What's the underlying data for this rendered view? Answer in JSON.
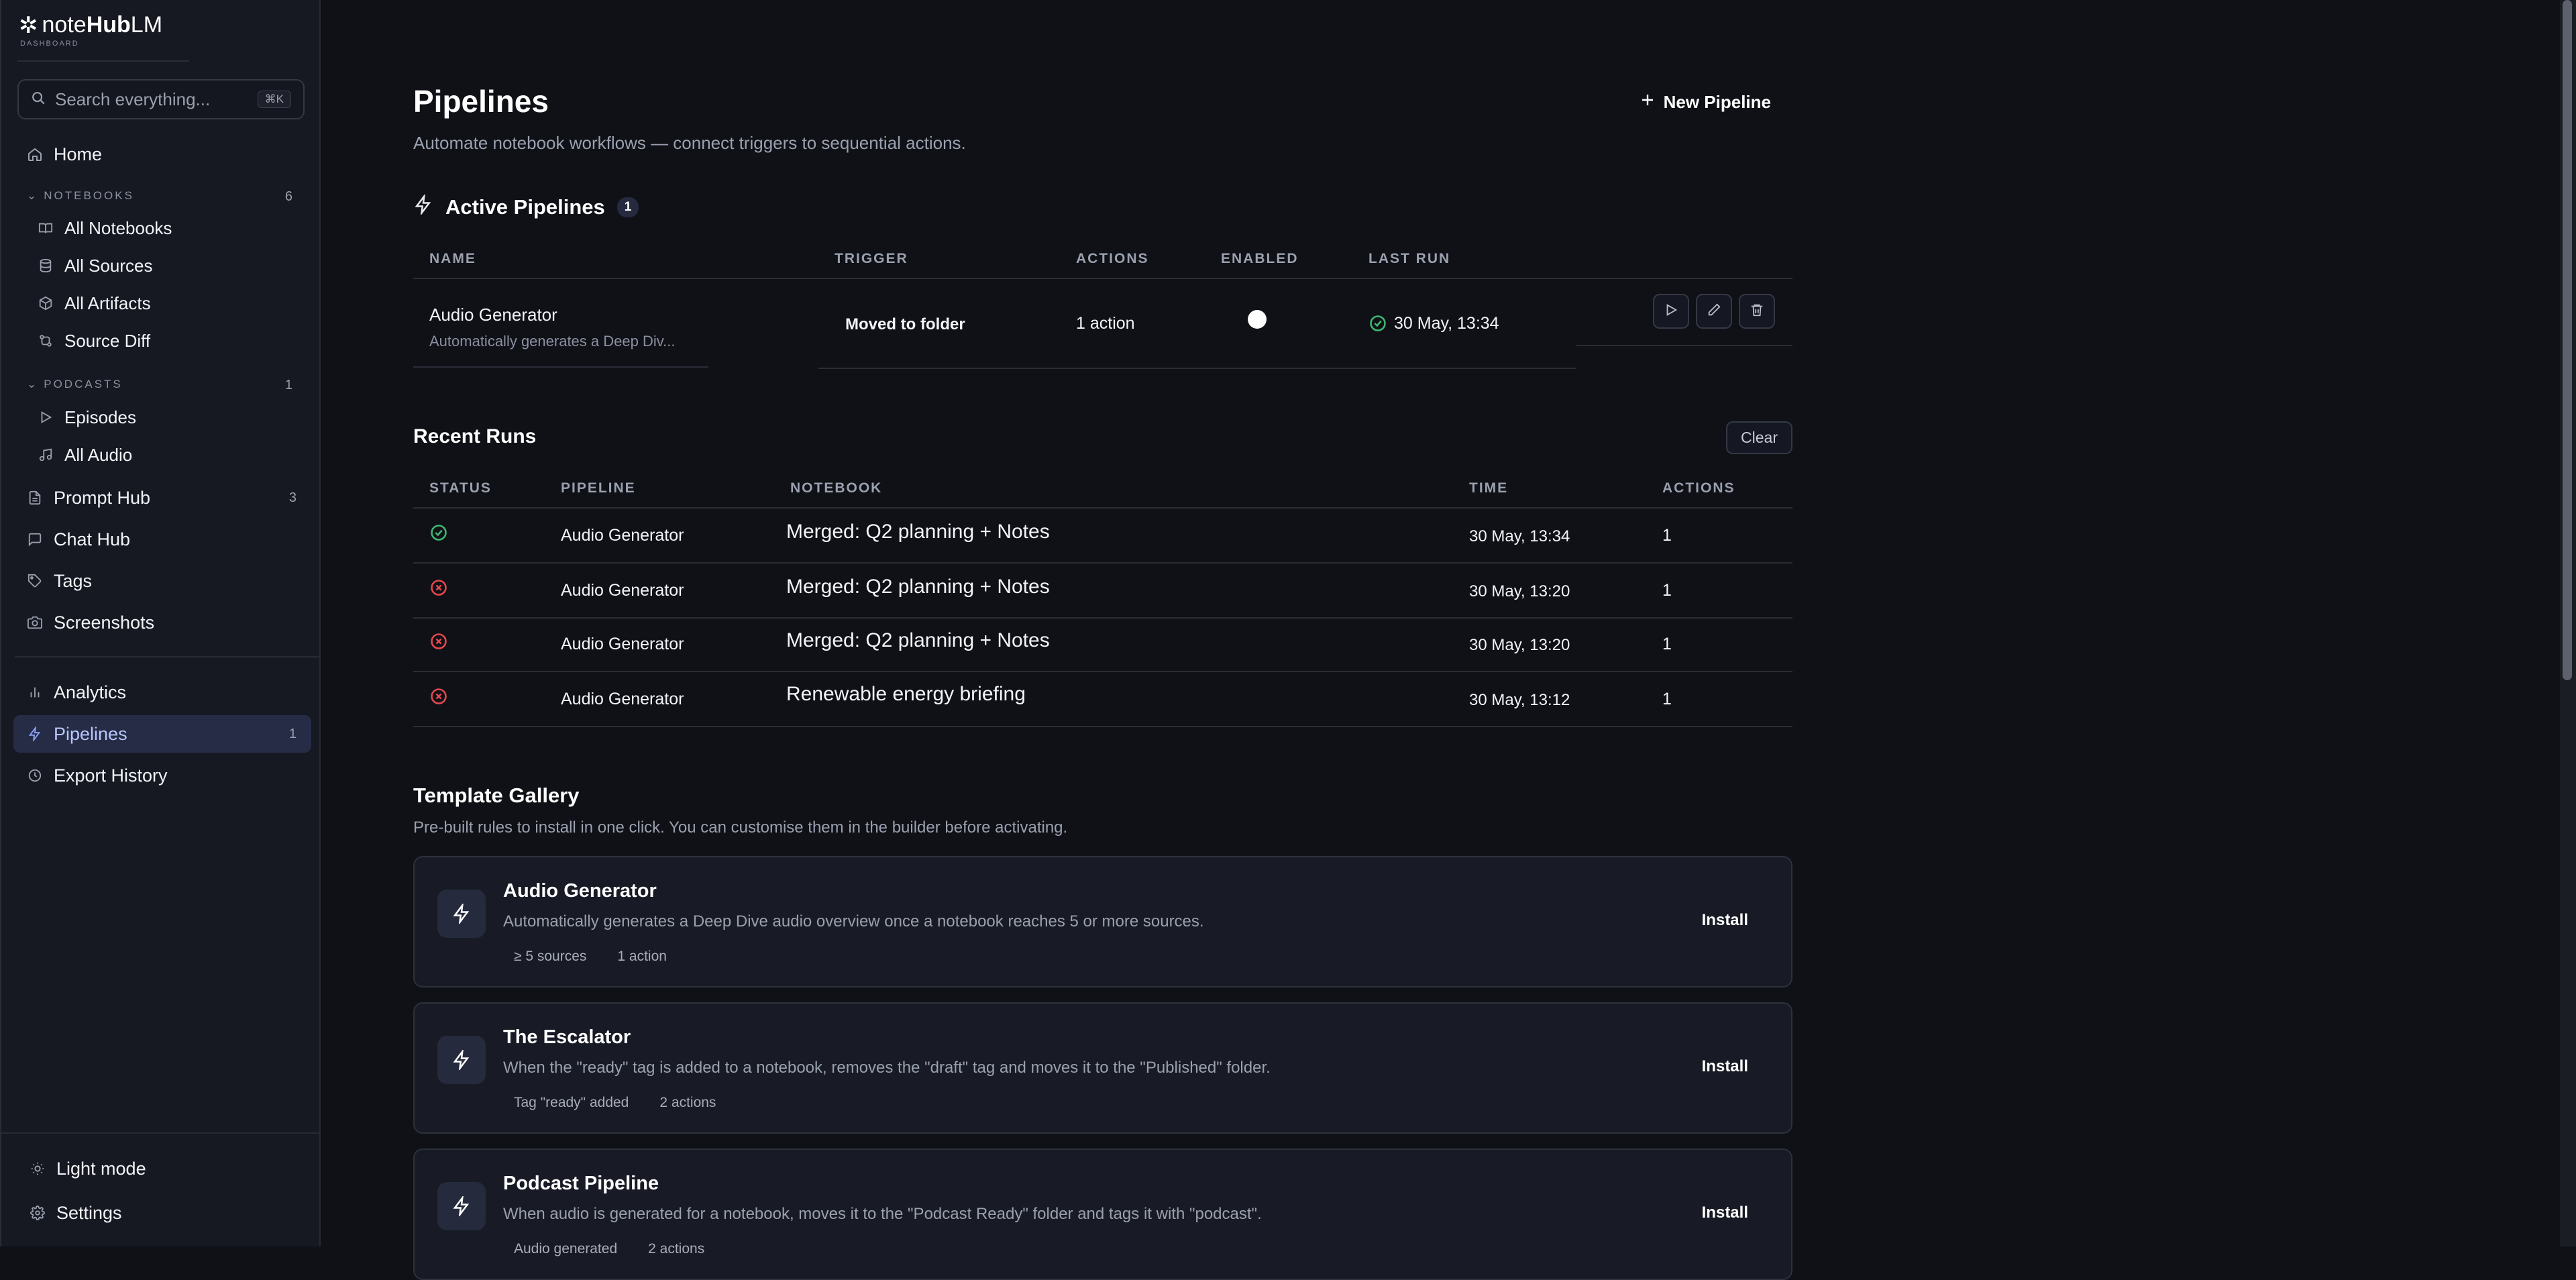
{
  "brand": {
    "name_prefix": "note",
    "name_hub": "Hub",
    "name_suffix": "LM",
    "subtitle": "DASHBOARD"
  },
  "search": {
    "placeholder": "Search everything...",
    "shortcut": "⌘K"
  },
  "sidebar": {
    "home": "Home",
    "notebooks_label": "NOTEBOOKS",
    "notebooks_count": "6",
    "notebooks_items": [
      "All Notebooks",
      "All Sources",
      "All Artifacts",
      "Source Diff"
    ],
    "podcasts_label": "PODCASTS",
    "podcasts_count": "1",
    "podcasts_items": [
      "Episodes",
      "All Audio"
    ],
    "prompt_hub": "Prompt Hub",
    "prompt_hub_count": "3",
    "chat_hub": "Chat Hub",
    "tags": "Tags",
    "screenshots": "Screenshots",
    "analytics": "Analytics",
    "pipelines": "Pipelines",
    "pipelines_count": "1",
    "export_history": "Export History",
    "light_mode": "Light mode",
    "settings": "Settings"
  },
  "page": {
    "title": "Pipelines",
    "subtitle": "Automate notebook workflows — connect triggers to sequential actions.",
    "new_button": "New Pipeline"
  },
  "active": {
    "title": "Active Pipelines",
    "count": "1",
    "headers": [
      "NAME",
      "TRIGGER",
      "ACTIONS",
      "ENABLED",
      "LAST RUN"
    ],
    "row": {
      "name": "Audio Generator",
      "description": "Automatically generates a Deep Div...",
      "trigger": "Moved to folder",
      "actions": "1 action",
      "enabled": true,
      "last_run": "30 May, 13:34",
      "last_run_status": "success"
    }
  },
  "recent": {
    "title": "Recent Runs",
    "clear": "Clear",
    "headers": [
      "STATUS",
      "PIPELINE",
      "NOTEBOOK",
      "TIME",
      "ACTIONS"
    ],
    "rows": [
      {
        "status": "success",
        "pipeline": "Audio Generator",
        "notebook": "Merged: Q2 planning + Notes",
        "time": "30 May, 13:34",
        "actions": "1"
      },
      {
        "status": "error",
        "pipeline": "Audio Generator",
        "notebook": "Merged: Q2 planning + Notes",
        "time": "30 May, 13:20",
        "actions": "1"
      },
      {
        "status": "error",
        "pipeline": "Audio Generator",
        "notebook": "Merged: Q2 planning + Notes",
        "time": "30 May, 13:20",
        "actions": "1"
      },
      {
        "status": "error",
        "pipeline": "Audio Generator",
        "notebook": "Renewable energy briefing",
        "time": "30 May, 13:12",
        "actions": "1"
      }
    ]
  },
  "gallery": {
    "title": "Template Gallery",
    "subtitle": "Pre-built rules to install in one click. You can customise them in the builder before activating.",
    "install": "Install",
    "templates": [
      {
        "title": "Audio Generator",
        "description": "Automatically generates a Deep Dive audio overview once a notebook reaches 5 or more sources.",
        "chips": [
          "≥ 5 sources",
          "1 action"
        ]
      },
      {
        "title": "The Escalator",
        "description": "When the \"ready\" tag is added to a notebook, removes the \"draft\" tag and moves it to the \"Published\" folder.",
        "chips": [
          "Tag \"ready\" added",
          "2 actions"
        ]
      },
      {
        "title": "Podcast Pipeline",
        "description": "When audio is generated for a notebook, moves it to the \"Podcast Ready\" folder and tags it with \"podcast\".",
        "chips": [
          "Audio generated",
          "2 actions"
        ]
      }
    ]
  },
  "colors": {
    "accent": "#8fa4ff",
    "success": "#3fb970",
    "error": "#e5484d",
    "background": "#0f1117",
    "sidebar": "#161922"
  }
}
